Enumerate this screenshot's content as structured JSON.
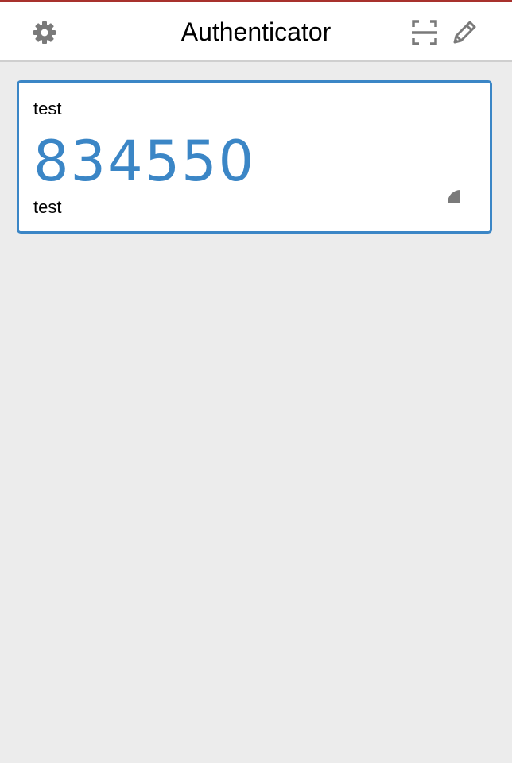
{
  "header": {
    "title": "Authenticator",
    "settings_icon": "gear-icon",
    "scan_icon": "scan-qr-icon",
    "edit_icon": "pencil-icon"
  },
  "entries": [
    {
      "issuer": "test",
      "code": "834550",
      "account": "test",
      "timer_icon": "countdown-pie-icon"
    }
  ],
  "colors": {
    "accent": "#3b86c6",
    "icon": "#7a7a7a",
    "background": "#ececec",
    "window_top_accent": "#a8312d"
  }
}
